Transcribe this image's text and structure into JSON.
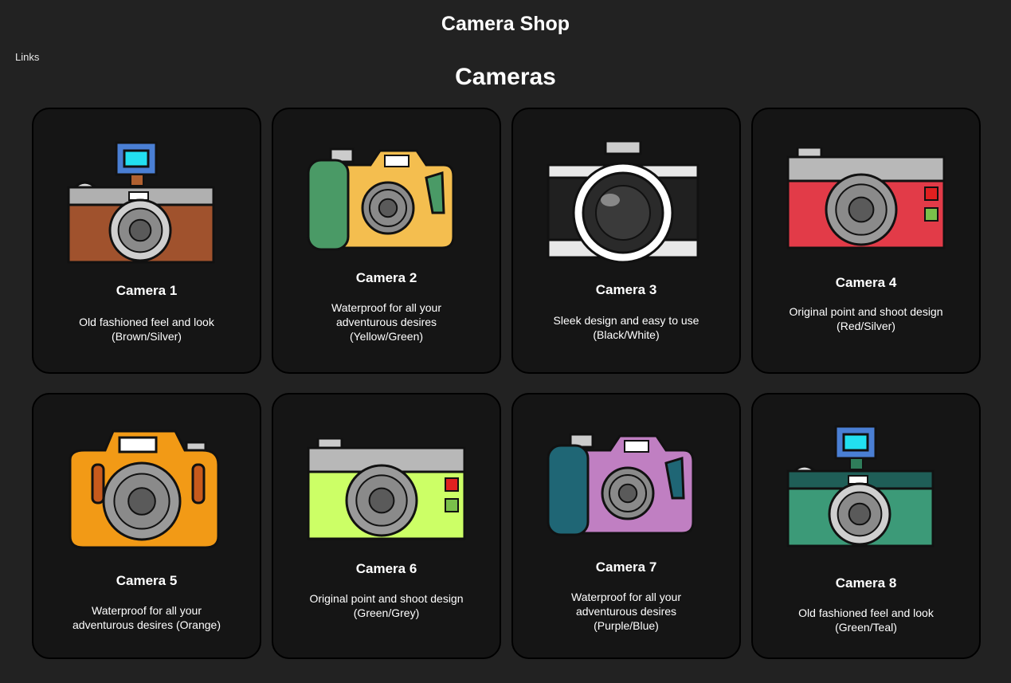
{
  "header": {
    "title": "Camera Shop",
    "links_label": "Links"
  },
  "section": {
    "title": "Cameras"
  },
  "cameras": [
    {
      "name": "Camera 1",
      "description": "Old fashioned feel and look (Brown/Silver)",
      "style": "vintage",
      "body_color": "#a0522d",
      "accent_color": "#b0b0b0"
    },
    {
      "name": "Camera 2",
      "description": "Waterproof for all your adventurous desires (Yellow/Green)",
      "style": "waterproof",
      "body_color": "#f4be4f",
      "accent_color": "#4a9a66"
    },
    {
      "name": "Camera 3",
      "description": "Sleek design and easy to use (Black/White)",
      "style": "sleek",
      "body_color": "#202020",
      "accent_color": "#ffffff"
    },
    {
      "name": "Camera 4",
      "description": "Original point and shoot design (Red/Silver)",
      "style": "point-shoot",
      "body_color": "#e23b48",
      "accent_color": "#b0b0b0"
    },
    {
      "name": "Camera 5",
      "description": "Waterproof for all your adventurous desires (Orange)",
      "style": "rounded",
      "body_color": "#f29a16",
      "accent_color": "#c85a1c"
    },
    {
      "name": "Camera 6",
      "description": "Original point and shoot design (Green/Grey)",
      "style": "point-shoot",
      "body_color": "#ccff66",
      "accent_color": "#b0b0b0"
    },
    {
      "name": "Camera 7",
      "description": "Waterproof for all your adventurous desires (Purple/Blue)",
      "style": "waterproof",
      "body_color": "#c07fc2",
      "accent_color": "#1f6675"
    },
    {
      "name": "Camera 8",
      "description": "Old fashioned feel and look (Green/Teal)",
      "style": "vintage",
      "body_color": "#3c9a78",
      "accent_color": "#1f5e57"
    }
  ]
}
